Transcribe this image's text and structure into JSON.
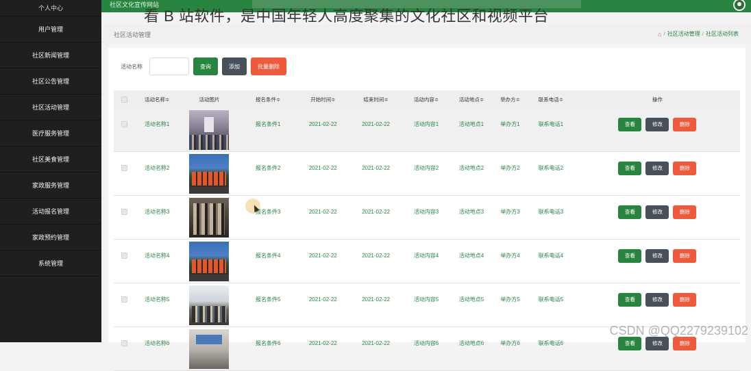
{
  "overlay_text": "看 B 站软件，是中国年轻人高度聚集的文化社区和视频平台",
  "watermark": "CSDN @QQ2279239102",
  "topbar": {
    "site_title": "社区文化宣传网站"
  },
  "sidebar": {
    "items": [
      {
        "label": "个人中心"
      },
      {
        "label": "用户管理"
      },
      {
        "label": "社区新闻管理"
      },
      {
        "label": "社区公告管理"
      },
      {
        "label": "社区活动管理"
      },
      {
        "label": "医疗服务管理"
      },
      {
        "label": "社区美食管理"
      },
      {
        "label": "家政服务管理"
      },
      {
        "label": "活动报名管理"
      },
      {
        "label": "家政预约管理"
      },
      {
        "label": "系统管理"
      }
    ]
  },
  "breadcrumb": {
    "page_title": "社区活动管理",
    "home_icon": "home-icon",
    "crumbs": [
      "社区活动管理",
      "社区活动列表"
    ]
  },
  "search": {
    "label": "活动名称",
    "value": "",
    "placeholder": "",
    "query_label": "查询",
    "add_label": "添加",
    "batch_delete_label": "批量删除"
  },
  "table": {
    "headers": {
      "name": "活动名称≑",
      "image": "活动图片",
      "cond": "报名条件≑",
      "start": "开始时间≑",
      "end": "结束时间≑",
      "content": "活动内容≑",
      "place": "活动地点≑",
      "org": "举办方≑",
      "phone": "联系电话≑",
      "ops": "操作"
    },
    "ops": {
      "view": "查看",
      "edit": "修改",
      "delete": "删除"
    },
    "rows": [
      {
        "name": "活动名称1",
        "cond": "报名条件1",
        "start": "2021-02-22",
        "end": "2021-02-22",
        "content": "活动内容1",
        "place": "活动地点1",
        "org": "举办方1",
        "phone": "联系电话1"
      },
      {
        "name": "活动名称2",
        "cond": "报名条件2",
        "start": "2021-02-22",
        "end": "2021-02-22",
        "content": "活动内容2",
        "place": "活动地点2",
        "org": "举办方2",
        "phone": "联系电话2"
      },
      {
        "name": "活动名称3",
        "cond": "报名条件3",
        "start": "2021-02-22",
        "end": "2021-02-22",
        "content": "活动内容3",
        "place": "活动地点3",
        "org": "举办方3",
        "phone": "联系电话3"
      },
      {
        "name": "活动名称4",
        "cond": "报名条件4",
        "start": "2021-02-22",
        "end": "2021-02-22",
        "content": "活动内容4",
        "place": "活动地点4",
        "org": "举办方4",
        "phone": "联系电话4"
      },
      {
        "name": "活动名称5",
        "cond": "报名条件5",
        "start": "2021-02-22",
        "end": "2021-02-22",
        "content": "活动内容5",
        "place": "活动地点5",
        "org": "举办方5",
        "phone": "联系电话5"
      },
      {
        "name": "活动名称6",
        "cond": "报名条件6",
        "start": "2021-02-22",
        "end": "2021-02-22",
        "content": "活动内容6",
        "place": "活动地点6",
        "org": "举办方6",
        "phone": "联系电话6"
      }
    ]
  },
  "colors": {
    "accent": "#27853f",
    "sidebar": "#1f1f1f",
    "danger": "#f05a3c",
    "dark_button": "#48505a"
  }
}
